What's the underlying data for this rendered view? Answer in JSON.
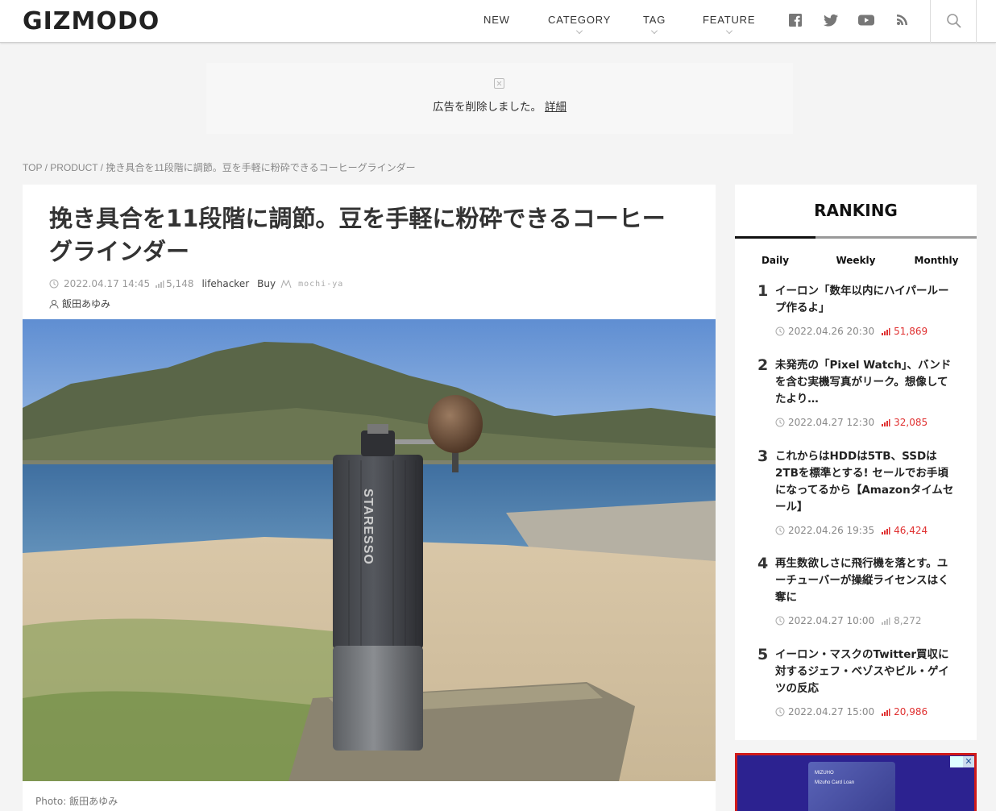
{
  "site": {
    "logo": "GIZMODO"
  },
  "nav": {
    "new": "NEW",
    "category": "CATEGORY",
    "tag": "TAG",
    "feature": "FEATURE"
  },
  "social_icons": [
    "facebook-icon",
    "twitter-icon",
    "youtube-icon",
    "rss-icon",
    "search-icon"
  ],
  "ad_notice": {
    "message": "広告を削除しました。",
    "link": "詳細"
  },
  "breadcrumb": "TOP / PRODUCT / 挽き具合を11段階に調節。豆を手軽に粉砕できるコーヒーグラインダー",
  "article": {
    "title": "挽き具合を11段階に調節。豆を手軽に粉砕できるコーヒーグラインダー",
    "date": "2022.04.17 14:45",
    "views": "5,148",
    "source": "lifehacker",
    "tag": "Buy",
    "partner": "mochi-ya",
    "author": "飯田あゆみ",
    "photo_credit": "Photo: 飯田あゆみ",
    "product_label": "STARESSO"
  },
  "ranking": {
    "heading": "RANKING",
    "tabs": [
      "Daily",
      "Weekly",
      "Monthly"
    ],
    "active_tab": "Daily",
    "items": [
      {
        "rank": "1",
        "title": "イーロン「数年以内にハイパーループ作るよ」",
        "date": "2022.04.26 20:30",
        "views": "51,869",
        "hot": true
      },
      {
        "rank": "2",
        "title": "未発売の「Pixel Watch」、バンドを含む実機写真がリーク。想像してたより…",
        "date": "2022.04.27 12:30",
        "views": "32,085",
        "hot": true
      },
      {
        "rank": "3",
        "title": "これからはHDDは5TB、SSDは2TBを標準とする! セールでお手頃になってるから【Amazonタイムセール】",
        "date": "2022.04.26 19:35",
        "views": "46,424",
        "hot": true
      },
      {
        "rank": "4",
        "title": "再生数欲しさに飛行機を落とす。ユーチューバーが操縦ライセンスはく奪に",
        "date": "2022.04.27 10:00",
        "views": "8,272",
        "hot": false
      },
      {
        "rank": "5",
        "title": "イーロン・マスクのTwitter買収に対するジェフ・ベゾスやビル・ゲイツの反応",
        "date": "2022.04.27 15:00",
        "views": "20,986",
        "hot": true
      }
    ]
  },
  "side_ad": {
    "brand": "MIZUHO",
    "card_label": "Mizuho Card Loan"
  },
  "colors": {
    "accent_red": "#e03030",
    "ad_bg": "#2c2290",
    "ad_border": "#d01a1a"
  }
}
